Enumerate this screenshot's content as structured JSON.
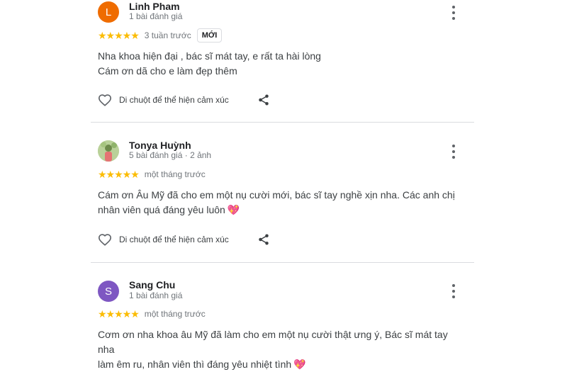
{
  "reviews": [
    {
      "avatar_letter": "L",
      "avatar_color": "#ef6c00",
      "name": "Linh Pham",
      "meta": "1 bài đánh giá",
      "stars": "★★★★★",
      "time": "3 tuần trước",
      "badge": "MỚI",
      "text_lines": [
        "Nha khoa hiện đại , bác sĩ mát tay, e rất ta hài lòng",
        "Cám ơn dã cho e làm đẹp thêm"
      ],
      "react_label": "Di chuột để thể hiện cảm xúc"
    },
    {
      "avatar_letter": "",
      "avatar_color": "#c5d9a3",
      "name": "Tonya Huỳnh",
      "meta": "5 bài đánh giá · 2 ảnh",
      "stars": "★★★★★",
      "time": "một tháng trước",
      "text_lines": [
        "Cám ơn Âu Mỹ đã cho em một nụ cười mới, bác sĩ tay nghề xịn nha. Các anh chị",
        "nhân viên quá đáng yêu luôn"
      ],
      "emoji": "💖",
      "react_label": "Di chuột để thể hiện cảm xúc"
    },
    {
      "avatar_letter": "S",
      "avatar_color": "#7e57c2",
      "name": "Sang Chu",
      "meta": "1 bài đánh giá",
      "stars": "★★★★★",
      "time": "một tháng trước",
      "text_lines": [
        "Cơm ơn nha khoa âu Mỹ đã làm cho em một nụ cười thật ưng ý, Bác sĩ mát tay nha",
        "làm êm ru, nhân viên thì đáng yêu nhiệt tình"
      ],
      "emoji": "💖"
    }
  ]
}
